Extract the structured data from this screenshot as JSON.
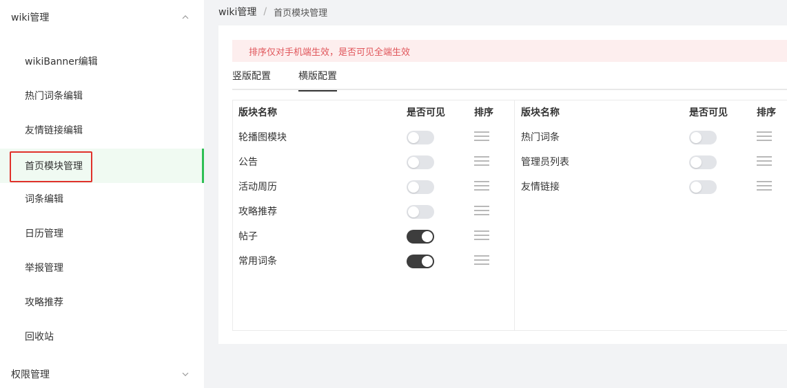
{
  "sidebar": {
    "group_wiki": "wiki管理",
    "items": [
      {
        "label": "wikiBanner编辑"
      },
      {
        "label": "热门词条编辑"
      },
      {
        "label": "友情链接编辑"
      },
      {
        "label": "首页模块管理"
      },
      {
        "label": "词条编辑"
      },
      {
        "label": "日历管理"
      },
      {
        "label": "举报管理"
      },
      {
        "label": "攻略推荐"
      },
      {
        "label": "回收站"
      }
    ],
    "group_perm": "权限管理",
    "active_index": 3
  },
  "breadcrumb": {
    "root": "wiki管理",
    "separator": "/",
    "current": "首页模块管理"
  },
  "alert": {
    "text": "排序仅对手机端生效，是否可见全端生效"
  },
  "tabs": [
    {
      "label": "竖版配置",
      "active": false
    },
    {
      "label": "横版配置",
      "active": true
    }
  ],
  "table": {
    "headers": {
      "name": "版块名称",
      "visible": "是否可见",
      "sort": "排序"
    },
    "left_rows": [
      {
        "name": "轮播图模块",
        "visible": false
      },
      {
        "name": "公告",
        "visible": false
      },
      {
        "name": "活动周历",
        "visible": false
      },
      {
        "name": "攻略推荐",
        "visible": false
      },
      {
        "name": "帖子",
        "visible": true
      },
      {
        "name": "常用词条",
        "visible": true
      }
    ],
    "right_rows": [
      {
        "name": "热门词条",
        "visible": false
      },
      {
        "name": "管理员列表",
        "visible": false
      },
      {
        "name": "友情链接",
        "visible": false
      }
    ]
  },
  "colors": {
    "accent_green": "#2fbf55",
    "highlight_red": "#e0302a",
    "alert_bg": "#fdeeee",
    "alert_text": "#e0555a",
    "switch_on": "#3d3d3d",
    "switch_off": "#e2e4e8"
  },
  "icons": {
    "group_wiki_chevron": "chevron-up-icon",
    "group_perm_chevron": "chevron-down-icon",
    "sort_handle": "drag-handle-icon"
  }
}
